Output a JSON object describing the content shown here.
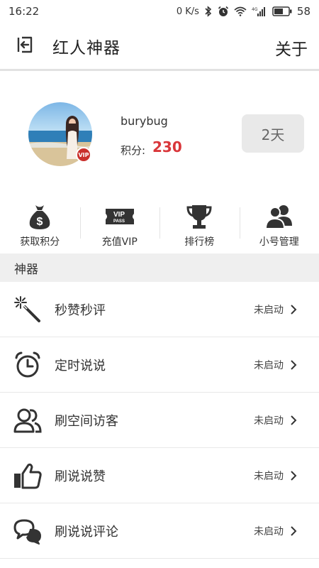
{
  "status_bar": {
    "time": "16:22",
    "net_speed": "0 K/s",
    "battery": "58"
  },
  "header": {
    "title": "红人神器",
    "about": "关于"
  },
  "profile": {
    "username": "burybug",
    "points_label": "积分:",
    "points_value": "230",
    "vip_badge": "VIP",
    "days_button": "2天"
  },
  "actions": [
    {
      "label": "获取积分",
      "icon": "money-bag-icon"
    },
    {
      "label": "充值VIP",
      "icon": "vip-pass-icon"
    },
    {
      "label": "排行榜",
      "icon": "trophy-icon"
    },
    {
      "label": "小号管理",
      "icon": "users-icon"
    }
  ],
  "section": {
    "title": "神器"
  },
  "tools": [
    {
      "label": "秒赞秒评",
      "status": "未启动",
      "icon": "magic-wand-icon"
    },
    {
      "label": "定时说说",
      "status": "未启动",
      "icon": "alarm-clock-icon"
    },
    {
      "label": "刷空间访客",
      "status": "未启动",
      "icon": "visitors-icon"
    },
    {
      "label": "刷说说赞",
      "status": "未启动",
      "icon": "thumbs-up-icon"
    },
    {
      "label": "刷说说评论",
      "status": "未启动",
      "icon": "comments-icon"
    }
  ]
}
